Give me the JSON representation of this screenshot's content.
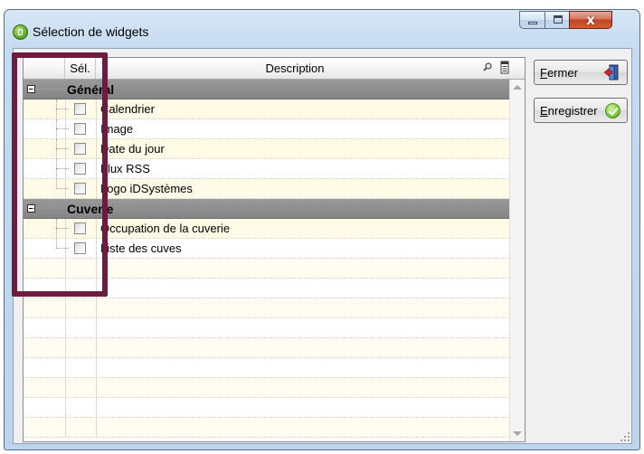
{
  "window": {
    "title": "Sélection de widgets",
    "close_glyph": "x"
  },
  "grid": {
    "columns": {
      "selection": "Sél.",
      "description": "Description"
    },
    "groups": [
      {
        "title": "Général",
        "items": [
          {
            "label": "Calendrier",
            "checked": false
          },
          {
            "label": "Image",
            "checked": false
          },
          {
            "label": "Date du jour",
            "checked": false
          },
          {
            "label": "Flux RSS",
            "checked": false
          },
          {
            "label": "Logo iDSystèmes",
            "checked": false
          }
        ]
      },
      {
        "title": "Cuverie",
        "items": [
          {
            "label": "Occupation de la cuverie",
            "checked": false
          },
          {
            "label": "Liste des cuves",
            "checked": false
          }
        ]
      }
    ]
  },
  "buttons": {
    "close_first": "F",
    "close_rest": "ermer",
    "save_first": "E",
    "save_rest": "nregistrer"
  },
  "colors": {
    "highlight": "#6d1b3f",
    "group_row": "#8c8c8c",
    "item_row": "#fffbe6"
  }
}
